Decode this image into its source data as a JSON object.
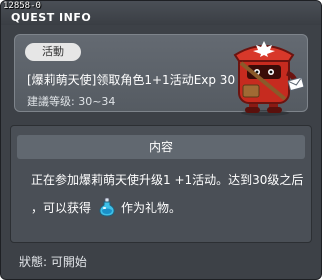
{
  "window": {
    "quest_id": "12858-0",
    "title": "QUEST INFO"
  },
  "quest": {
    "category_tag": "活動",
    "name": "[爆莉萌天使]领取角色1+1活动Exp 30",
    "required_level": "建議等级: 30~34"
  },
  "content": {
    "header": "内容",
    "line1": "正在参加爆莉萌天使升级1 +1活动。达到30级之后",
    "line2_prefix": "，可以获得",
    "line2_suffix": "作为礼物。",
    "reward_icon": "potion-icon"
  },
  "footer": {
    "status": "狀態: 可開始"
  }
}
